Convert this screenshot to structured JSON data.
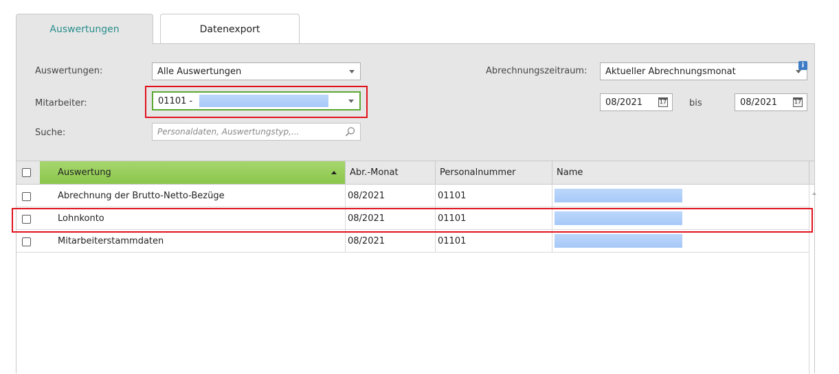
{
  "tabs": [
    {
      "label": "Auswertungen",
      "active": true
    },
    {
      "label": "Datenexport",
      "active": false
    }
  ],
  "filters": {
    "auswertungen_label": "Auswertungen:",
    "auswertungen_value": "Alle Auswertungen",
    "mitarbeiter_label": "Mitarbeiter:",
    "mitarbeiter_value": "01101 -",
    "suche_label": "Suche:",
    "suche_placeholder": "Personaldaten, Auswertungstyp,...",
    "zeitraum_label": "Abrechnungszeitraum:",
    "zeitraum_value": "Aktueller Abrechnungsmonat",
    "date_from": "08/2021",
    "bis_label": "bis",
    "date_to": "08/2021",
    "calendar_icon_text": "17",
    "info_badge": "i"
  },
  "table": {
    "headers": [
      "Auswertung",
      "Abr.-Monat",
      "Personalnummer",
      "Name"
    ],
    "rows": [
      {
        "auswertung": "Abrechnung der Brutto-Netto-Bezüge",
        "monat": "08/2021",
        "personalnummer": "01101"
      },
      {
        "auswertung": "Lohnkonto",
        "monat": "08/2021",
        "personalnummer": "01101"
      },
      {
        "auswertung": "Mitarbeiterstammdaten",
        "monat": "08/2021",
        "personalnummer": "01101"
      }
    ]
  },
  "colors": {
    "accent_teal": "#2a8d8d",
    "sorted_header_green": "#8bc64c",
    "highlight_red": "#e0101a",
    "focus_green": "#5aa832"
  }
}
